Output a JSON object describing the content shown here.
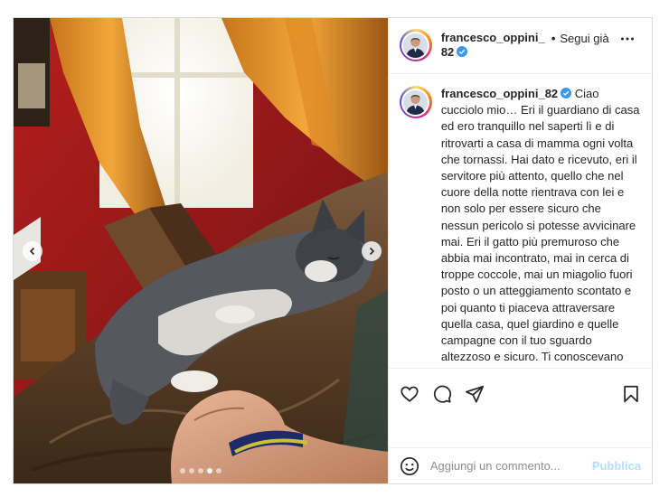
{
  "post": {
    "author": {
      "username": "francesco_oppini_82",
      "verified": true
    },
    "follow": {
      "separator": "•",
      "label": "Segui già"
    },
    "caption": {
      "username": "francesco_oppini_82",
      "text": "Ciao cucciolo mio… Eri il guardiano di casa ed ero tranquillo nel saperti lì e di ritrovarti a casa di mamma ogni volta che tornassi. Hai dato e ricevuto, eri il servitore più attento, quello che nel cuore della notte rientrava con lei e non solo per essere sicuro che nessun pericolo si potesse avvicinare mai. Eri il gatto più premuroso che abbia mai incontrato, mai in cerca di troppe coccole, mai un miagolio fuori posto o un atteggiamento scontato e poi quanto ti piaceva attraversare quella casa, quel giardino e quelle campagne con il tuo sguardo altezzoso e sicuro. Ti conoscevano come il gattone di Basiglio di Francesco e Alba, dalle foto non si capisce bene ma io un gatto"
    },
    "carousel": {
      "count": 5,
      "active_index": 3
    },
    "icons": {
      "like": "heart-icon",
      "comment": "comment-icon",
      "share": "share-icon",
      "save": "bookmark-icon",
      "emoji": "emoji-icon",
      "more": "more-dots-icon",
      "prev": "chevron-left-icon",
      "next": "chevron-right-icon"
    },
    "comment_box": {
      "placeholder": "Aggiungi un commento...",
      "publish_label": "Pubblica"
    },
    "colors": {
      "verified_blue": "#3897f0",
      "publish_disabled": "#b2dffc",
      "border": "#dbdbdb"
    }
  }
}
